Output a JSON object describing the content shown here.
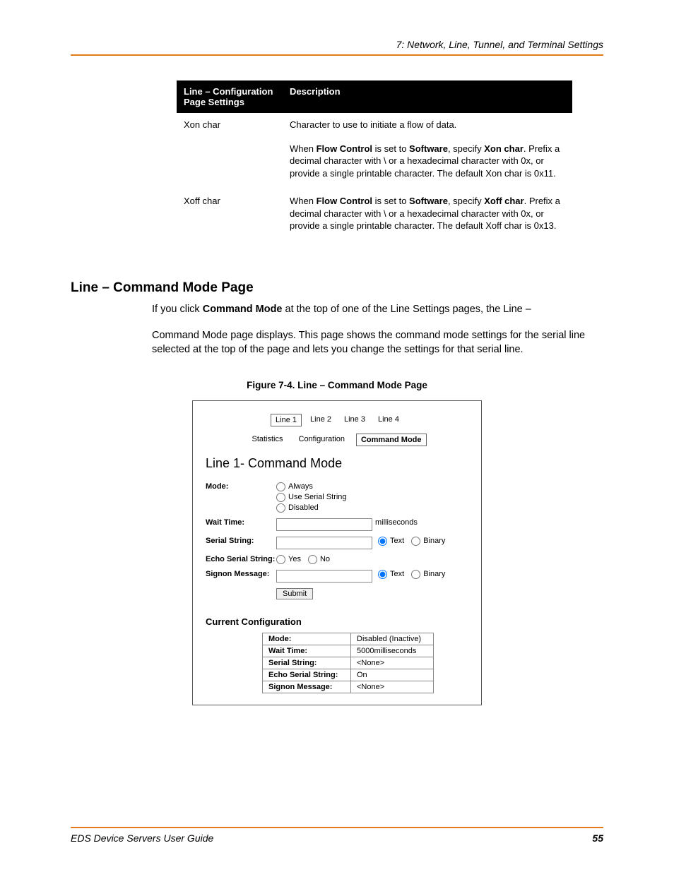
{
  "running_head": "7: Network, Line, Tunnel, and Terminal Settings",
  "ref_table": {
    "head": {
      "col1": "Line – Configuration Page Settings",
      "col2": "Description"
    },
    "rows": [
      {
        "setting": "Xon char",
        "desc_line1": "Character to use to initiate a flow of data.",
        "desc_line2_pre": "When ",
        "desc_line2_b1": "Flow Control",
        "desc_line2_mid1": " is set to ",
        "desc_line2_b2": "Software",
        "desc_line2_mid2": ", specify ",
        "desc_line2_b3": "Xon char",
        "desc_line2_post": ". Prefix a decimal character with \\ or a hexadecimal character with 0x, or provide a single printable character. The default Xon char is 0x11."
      },
      {
        "setting": "Xoff char",
        "desc_line2_pre": "When ",
        "desc_line2_b1": "Flow Control",
        "desc_line2_mid1": " is set to ",
        "desc_line2_b2": "Software",
        "desc_line2_mid2": ", specify ",
        "desc_line2_b3": "Xoff char",
        "desc_line2_post": ". Prefix a decimal character with \\ or a hexadecimal character with 0x, or provide a single printable character. The default Xoff char is 0x13."
      }
    ]
  },
  "section_heading": "Line – Command Mode Page",
  "para1_pre": "If you click ",
  "para1_b": "Command Mode",
  "para1_post": " at the top of one of the Line Settings pages, the Line –",
  "para2": "Command Mode page displays. This page shows the command mode settings for the serial line selected at the top of the page and lets you change the settings for that serial line.",
  "fig_caption": "Figure 7-4. Line – Command Mode Page",
  "screenshot": {
    "line_tabs": [
      "Line 1",
      "Line 2",
      "Line 3",
      "Line 4"
    ],
    "active_line_tab": 0,
    "sub_tabs": [
      "Statistics",
      "Configuration",
      "Command Mode"
    ],
    "active_sub_tab": 2,
    "panel_title": "Line 1- Command Mode",
    "labels": {
      "mode": "Mode:",
      "wait_time": "Wait Time:",
      "serial_string": "Serial String:",
      "echo": "Echo Serial String:",
      "signon": "Signon Message:"
    },
    "mode_options": [
      "Always",
      "Use Serial String",
      "Disabled"
    ],
    "wait_unit": " milliseconds",
    "format_opts": {
      "text": "Text",
      "binary": "Binary"
    },
    "yn": {
      "yes": "Yes",
      "no": "No"
    },
    "submit": "Submit",
    "cc_title": "Current Configuration",
    "cc_rows": [
      {
        "k": "Mode:",
        "v": "Disabled (Inactive)"
      },
      {
        "k": "Wait Time:",
        "v": "5000milliseconds"
      },
      {
        "k": "Serial String:",
        "v": "<None>"
      },
      {
        "k": "Echo Serial String:",
        "v": "On"
      },
      {
        "k": "Signon Message:",
        "v": "<None>"
      }
    ]
  },
  "footer": {
    "left": "EDS Device Servers User Guide",
    "right": "55"
  }
}
